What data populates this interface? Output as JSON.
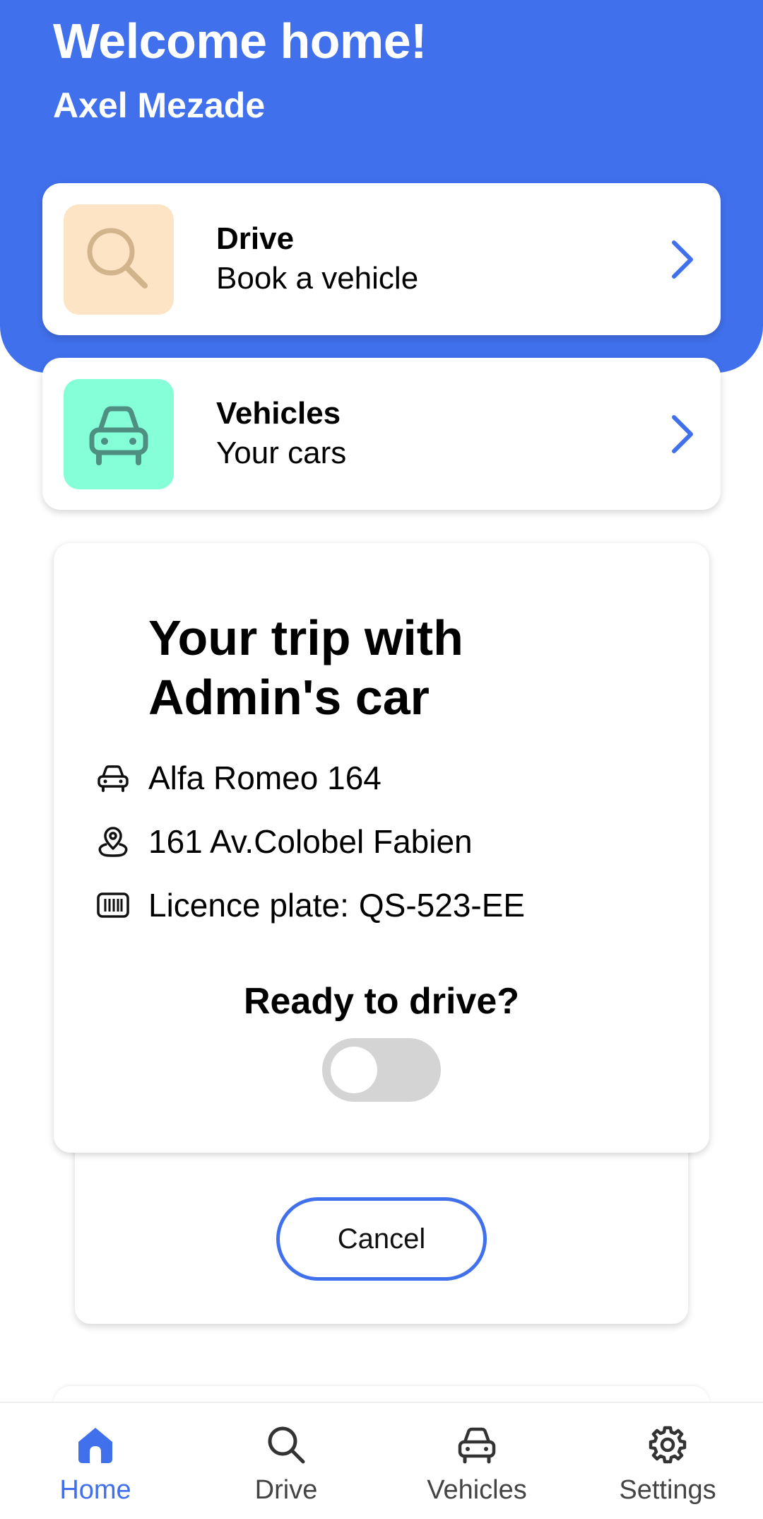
{
  "header": {
    "welcome": "Welcome home!",
    "user_name": "Axel Mezade"
  },
  "nav_cards": [
    {
      "title": "Drive",
      "subtitle": "Book a vehicle",
      "icon": "search-icon",
      "tile_color": "#fde4c4"
    },
    {
      "title": "Vehicles",
      "subtitle": "Your cars",
      "icon": "car-icon",
      "tile_color": "#84ffd8"
    }
  ],
  "trip": {
    "title": "Your trip with Admin's car",
    "car_model": "Alfa Romeo 164",
    "address": "161 Av.Colobel Fabien",
    "plate_label": "Licence plate:",
    "plate_value": "QS-523-EE",
    "ready_label": "Ready to drive?",
    "ready_toggle_on": false,
    "cancel_label": "Cancel"
  },
  "bottom_nav": [
    {
      "label": "Home",
      "icon": "home-icon",
      "active": true
    },
    {
      "label": "Drive",
      "icon": "search-icon",
      "active": false
    },
    {
      "label": "Vehicles",
      "icon": "car-icon",
      "active": false
    },
    {
      "label": "Settings",
      "icon": "gear-icon",
      "active": false
    }
  ],
  "colors": {
    "primary": "#4170ec",
    "toggle_off": "#d4d4d4"
  }
}
